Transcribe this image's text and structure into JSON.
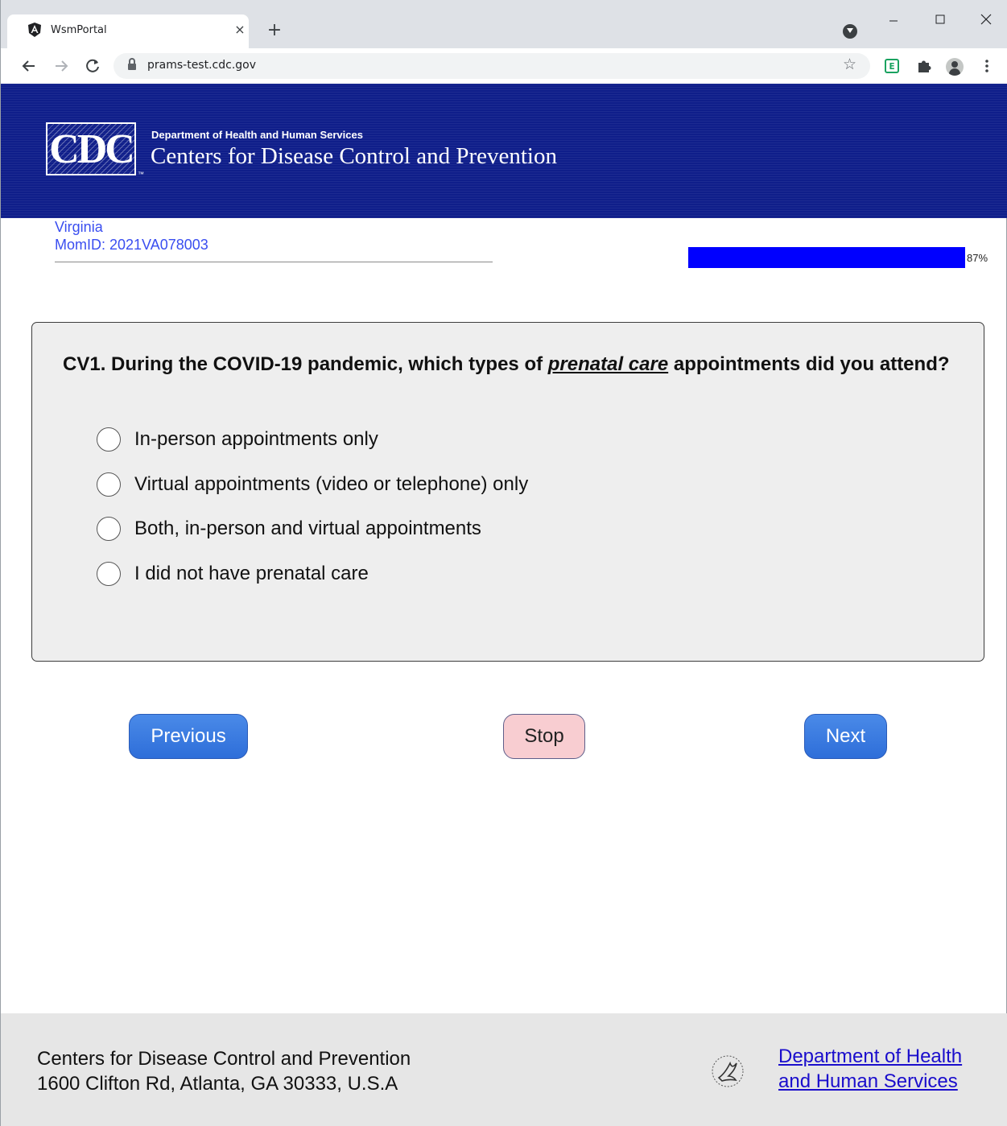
{
  "browser": {
    "tab_title": "WsmPortal",
    "tab_close": "×",
    "new_tab": "+",
    "url": "prams-test.cdc.gov",
    "icons": [
      "angular-favicon",
      "back-icon",
      "forward-icon",
      "reload-icon",
      "lock-icon",
      "star-icon",
      "extension-icon",
      "puzzle-icon",
      "avatar-icon",
      "kebab-menu-icon",
      "minimize-icon",
      "maximize-icon",
      "close-window-icon"
    ]
  },
  "banner": {
    "logo_text": "CDC",
    "department": "Department of Health and Human Services",
    "agency": "Centers for Disease Control and Prevention",
    "background_color": "#0f1e8a"
  },
  "respondent": {
    "state": "Virginia",
    "mom_id": "MomID: 2021VA078003"
  },
  "progress": {
    "percent": 87,
    "label": "87%",
    "fill_color": "#0000ff"
  },
  "question": {
    "prefix": "CV1. During the COVID-19 pandemic, which types of ",
    "emphasis": "prenatal care",
    "suffix": " appointments did you attend?",
    "options": [
      "In-person appointments only",
      "Virtual appointments (video or telephone) only",
      "Both, in-person and virtual appointments",
      "I did not have prenatal care"
    ]
  },
  "buttons": {
    "previous": "Previous",
    "stop": "Stop",
    "next": "Next"
  },
  "footer": {
    "org_name": "Centers for Disease Control and Prevention",
    "address": "1600 Clifton Rd, Atlanta, GA 30333, U.S.A",
    "hhs_link_line1": "Department of Health",
    "hhs_link_line2": "and Human Services"
  }
}
